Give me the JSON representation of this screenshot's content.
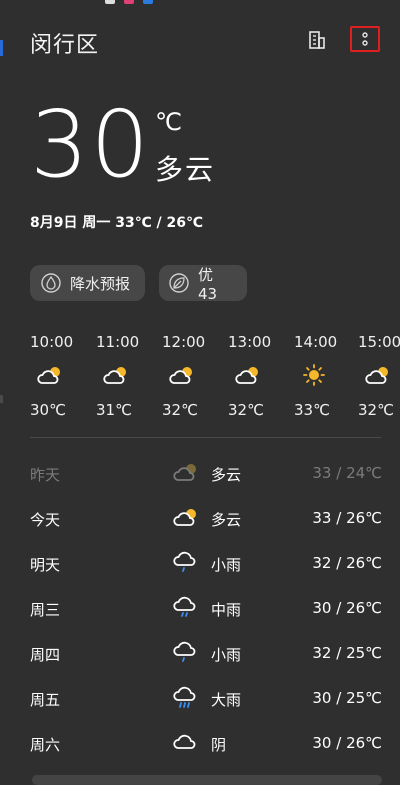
{
  "colors": {
    "background": "#2f2f2f",
    "chip_bg": "#474747",
    "sun": "#f5b82a",
    "rain": "#3f8ef0",
    "highlight_box": "#e02020"
  },
  "location": {
    "city": "闵行区"
  },
  "header_icons": {
    "building": "building-icon",
    "more": "more-options-icon"
  },
  "current": {
    "temp": "30",
    "unit": "℃",
    "condition": "多云",
    "date_line": "8月9日 周一   33℃ / 26℃"
  },
  "chips": [
    {
      "icon": "raindrop-icon",
      "label": "降水预报"
    },
    {
      "icon": "leaf-icon",
      "label": "优 43"
    }
  ],
  "hourly": [
    {
      "time": "10:00",
      "icon": "partly-cloudy-icon",
      "temp": "30℃"
    },
    {
      "time": "11:00",
      "icon": "partly-cloudy-icon",
      "temp": "31℃"
    },
    {
      "time": "12:00",
      "icon": "partly-cloudy-icon",
      "temp": "32℃"
    },
    {
      "time": "13:00",
      "icon": "partly-cloudy-icon",
      "temp": "32℃"
    },
    {
      "time": "14:00",
      "icon": "sunny-icon",
      "temp": "33℃"
    },
    {
      "time": "15:00",
      "icon": "partly-cloudy-icon",
      "temp": "32℃"
    }
  ],
  "daily": [
    {
      "day": "昨天",
      "icon": "partly-cloudy-icon",
      "condition": "多云",
      "range": "33 / 24℃",
      "past": true
    },
    {
      "day": "今天",
      "icon": "partly-cloudy-icon",
      "condition": "多云",
      "range": "33 / 26℃",
      "past": false
    },
    {
      "day": "明天",
      "icon": "light-rain-icon",
      "condition": "小雨",
      "range": "32 / 26℃",
      "past": false
    },
    {
      "day": "周三",
      "icon": "moderate-rain-icon",
      "condition": "中雨",
      "range": "30 / 26℃",
      "past": false
    },
    {
      "day": "周四",
      "icon": "light-rain-icon",
      "condition": "小雨",
      "range": "32 / 25℃",
      "past": false
    },
    {
      "day": "周五",
      "icon": "heavy-rain-icon",
      "condition": "大雨",
      "range": "30 / 25℃",
      "past": false
    },
    {
      "day": "周六",
      "icon": "cloudy-icon",
      "condition": "阴",
      "range": "30 / 26℃",
      "past": false
    }
  ]
}
